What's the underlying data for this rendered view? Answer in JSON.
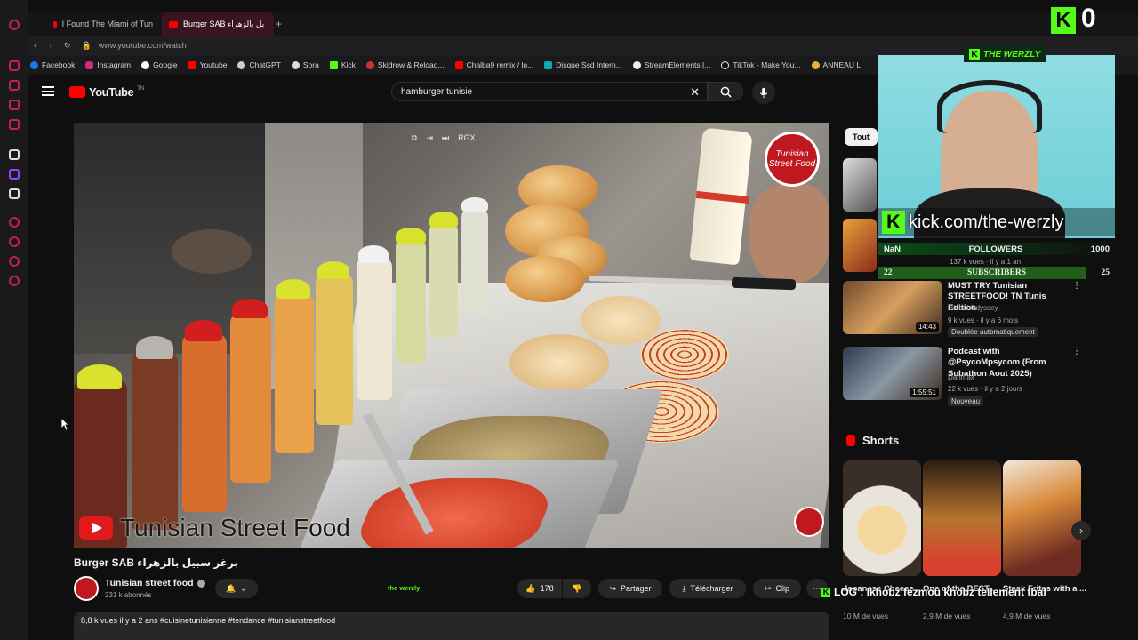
{
  "browser": {
    "tabs": [
      {
        "label": "I Found The Miami of Tun",
        "active": false
      },
      {
        "label": "Burger SAB بل بالزهراء",
        "active": true
      }
    ],
    "address": "www.youtube.com/watch",
    "bookmarks": [
      "Facebook",
      "Instagram",
      "Google",
      "Youtube",
      "ChatGPT",
      "Sora",
      "Kick",
      "Skidrow & Reload...",
      "Chalba9 remix / lo...",
      "Disque Ssd Intern...",
      "StreamElements |...",
      "TikTok - Make You...",
      "ANNEAU L"
    ]
  },
  "youtube": {
    "logo": "YouTube",
    "country": "TN",
    "search_value": "hamburger tunisie",
    "filter_chip": "Tout"
  },
  "player": {
    "watermark_text": "Tunisian Street Food",
    "badge_text": "Tunisian Street Food",
    "controls_label": "RGX"
  },
  "video": {
    "title": "Burger SAB برغر سبيل بالزهراء",
    "channel": "Tunisian street food",
    "subscribers": "231 k abonnés",
    "likes": "178",
    "share": "Partager",
    "download": "Télécharger",
    "clip": "Clip",
    "stream_tag": "the werzly",
    "description": "8,8 k vues   il y a 2 ans  #cuisinetunisienne #tendance #tunisianstreetfood"
  },
  "recommendations": [
    {
      "title": "MUST TRY Tunisian STREETFOOD! TN Tunis Edition",
      "channel": "Global Odyssey",
      "meta": "9 k vues · il y a 6 mois",
      "badge": "Doublée automatiquement",
      "duration": "14:43"
    },
    {
      "title": "Podcast with @PsycoMpsycom (From Subathon Aout 2025)",
      "channel": "Dahmax",
      "meta": "22 k vues · il y a 2 jours",
      "badge": "Nouveau",
      "duration": "1:55:51"
    }
  ],
  "partial_meta": "137 k vues · il y a 1 an",
  "shorts": {
    "heading": "Shorts",
    "items": [
      {
        "title": "Japanese Cheese ...",
        "views": "10 M de vues"
      },
      {
        "title": "One of the BEST ...",
        "views": "2,9 M de vues"
      },
      {
        "title": "Steak Frites with a ...",
        "views": "4,9 M de vues"
      }
    ]
  },
  "overlay": {
    "header": "THE WERZLY",
    "kick_url": "kick.com/the-werzly",
    "followers_label": "FOLLOWERS",
    "followers_current": "NaN",
    "followers_goal": "1000",
    "subs_label": "SUBSCRIBERS",
    "subs_current": "22",
    "subs_goal": "25",
    "marquee": "LOG : lkhobz fezmou khobz tellement tbal",
    "top_counter": "0"
  },
  "colors": {
    "brand_red": "#ff0000",
    "kick_green": "#53fc18",
    "opera_red": "#c3214f"
  }
}
